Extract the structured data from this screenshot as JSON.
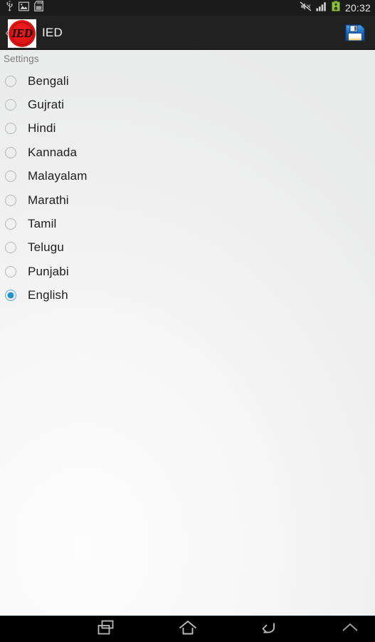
{
  "status_bar": {
    "icons": [
      "usb-icon",
      "image-icon",
      "sd-card-icon"
    ],
    "right_icons": [
      "mute-vibrate-icon",
      "signal-bars-icon",
      "battery-icon"
    ],
    "time": "20:32",
    "background_color": "#1b1b1b"
  },
  "action_bar": {
    "back_chevron": "‹",
    "logo_text": "IED",
    "logo_name": "ied-app-logo",
    "title": "IED",
    "save_icon": "floppy-disk-save-icon",
    "background_color": "#212121",
    "title_color": "#f2f2f2"
  },
  "content": {
    "section_label": "Settings",
    "accent_color": "#2196cd",
    "radio_options": [
      {
        "label": "Bengali",
        "selected": false
      },
      {
        "label": "Gujrati",
        "selected": false
      },
      {
        "label": "Hindi",
        "selected": false
      },
      {
        "label": "Kannada",
        "selected": false
      },
      {
        "label": "Malayalam",
        "selected": false
      },
      {
        "label": "Marathi",
        "selected": false
      },
      {
        "label": "Tamil",
        "selected": false
      },
      {
        "label": "Telugu",
        "selected": false
      },
      {
        "label": "Punjabi",
        "selected": false
      },
      {
        "label": "English",
        "selected": true
      }
    ]
  },
  "navigation_bar": {
    "buttons": [
      {
        "name": "recents-icon"
      },
      {
        "name": "home-icon"
      },
      {
        "name": "back-icon"
      },
      {
        "name": "expand-chevron-up-icon"
      }
    ],
    "background_color": "#000000"
  }
}
